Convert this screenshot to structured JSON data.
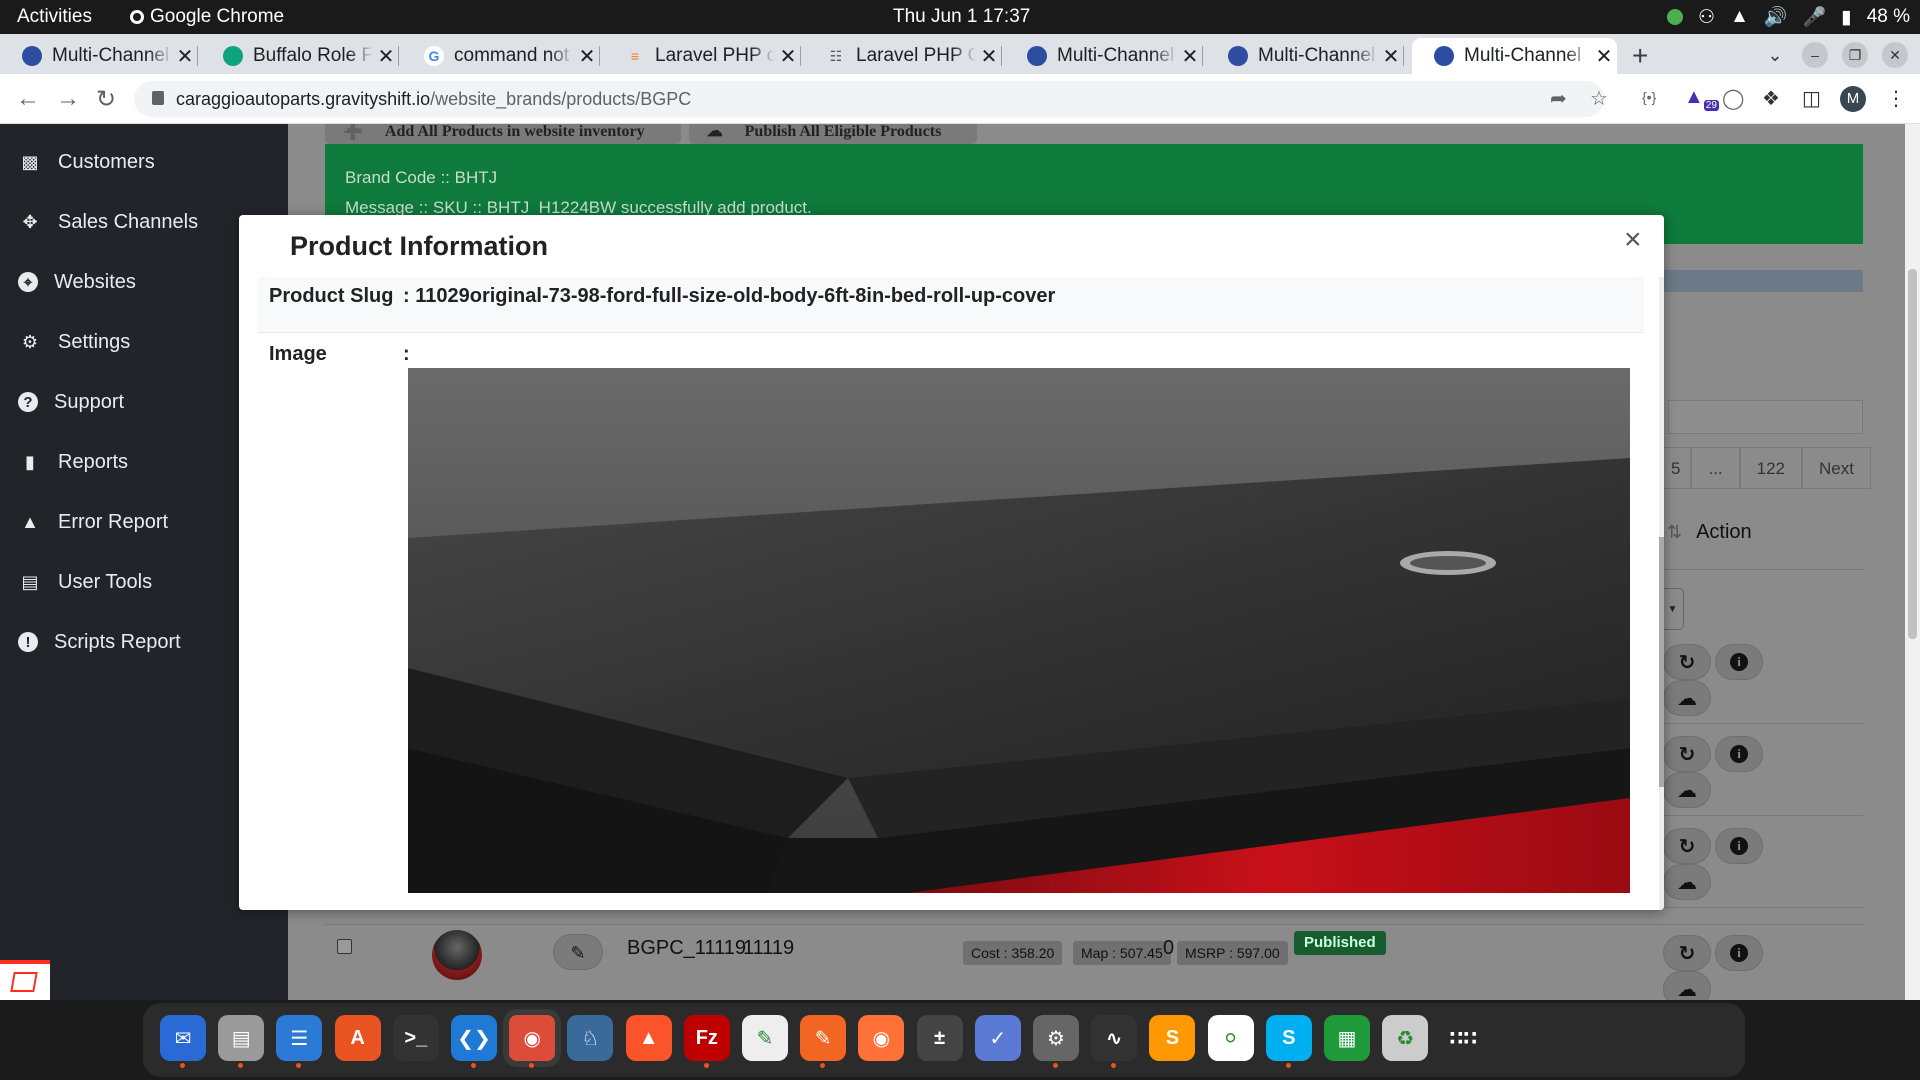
{
  "topbar": {
    "activities": "Activities",
    "app_name": "Google Chrome",
    "clock": "Thu Jun 1  17:37",
    "battery": "48 %"
  },
  "tabs": [
    {
      "label": "Multi-Channel",
      "favicon": "globe-icon",
      "color": "#2d4ea0"
    },
    {
      "label": "Buffalo Role F",
      "favicon": "chatgpt-icon",
      "color": "#10a37f"
    },
    {
      "label": "command not",
      "favicon": "google-icon",
      "color": "#4285f4"
    },
    {
      "label": "Laravel PHP cc",
      "favicon": "stackoverflow-icon",
      "color": "#f48024"
    },
    {
      "label": "Laravel PHP C",
      "favicon": "laravel-icon",
      "color": "#555"
    },
    {
      "label": "Multi-Channel",
      "favicon": "globe-icon",
      "color": "#2d4ea0"
    },
    {
      "label": "Multi-Channel",
      "favicon": "globe-icon",
      "color": "#2d4ea0"
    },
    {
      "label": "Multi-Channel",
      "favicon": "globe-icon",
      "color": "#2d4ea0",
      "active": true
    }
  ],
  "address": {
    "host": "caraggioautoparts.gravityshift.io",
    "path": "/website_brands/products/BGPC",
    "extensions_badge": "29",
    "profile_initial": "M"
  },
  "sidebar": {
    "items": [
      {
        "label": "Customers",
        "icon": "address-book-icon"
      },
      {
        "label": "Sales Channels",
        "icon": "arrows-icon"
      },
      {
        "label": "Websites",
        "icon": "globe-icon"
      },
      {
        "label": "Settings",
        "icon": "gear-icon"
      },
      {
        "label": "Support",
        "icon": "question-circle-icon"
      },
      {
        "label": "Reports",
        "icon": "file-icon"
      },
      {
        "label": "Error Report",
        "icon": "warning-icon"
      },
      {
        "label": "User Tools",
        "icon": "desktop-icon"
      },
      {
        "label": "Scripts Report",
        "icon": "info-circle-icon"
      }
    ]
  },
  "page": {
    "btn_add_all": "Add All Products in website inventory",
    "btn_publish_all": "Publish All Eligible Products",
    "alert_brand": "Brand Code :: BHTJ",
    "alert_message": "Message :: SKU :: BHTJ_H1224BW successfully add product.",
    "pager": [
      "5",
      "...",
      "122",
      "Next"
    ],
    "action_header": "Action"
  },
  "row": {
    "sku": "BGPC_11119",
    "number": "11119",
    "cost": "Cost : 358.20",
    "map": "Map : 507.45",
    "msrp": "MSRP : 597.00",
    "qty": "0",
    "status": "Published"
  },
  "modal": {
    "title": "Product Information",
    "slug_label": "Product Slug",
    "slug_value": ": 11029original-73-98-ford-full-size-old-body-6ft-8in-bed-roll-up-cover",
    "image_label": "Image",
    "image_value": ":"
  },
  "dock": [
    "thunderbird-icon",
    "files-icon",
    "writer-icon",
    "app-center-icon",
    "terminal-icon",
    "vscode-icon",
    "chrome-icon",
    "mysql-workbench-icon",
    "brave-icon",
    "filezilla-icon",
    "text-editor-icon",
    "inkscape-icon",
    "firefox-icon",
    "calculator-icon",
    "tasks-icon",
    "settings-icon",
    "system-monitor-icon",
    "sublime-icon",
    "mongodb-icon",
    "skype-icon",
    "calc-icon",
    "trash-icon",
    "app-grid-icon"
  ]
}
